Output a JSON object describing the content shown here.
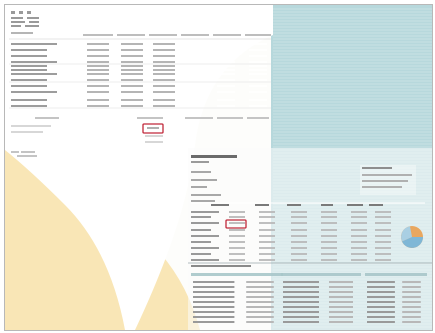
{
  "document": {
    "colors": {
      "teal": "#b7d8dc",
      "yellow": "#f9e6b6",
      "highlight_box": "#c0283a",
      "text_lines": "#b9b9b9",
      "pie_blue": "#7fb7d6",
      "pie_orange": "#e9a75f"
    },
    "highlights": [
      {
        "name": "highlight-box-summary-value"
      },
      {
        "name": "highlight-box-detail-value"
      }
    ],
    "icons": [
      "pie-chart-icon"
    ],
    "page_one": {
      "text": ""
    },
    "page_two": {
      "text": ""
    }
  }
}
